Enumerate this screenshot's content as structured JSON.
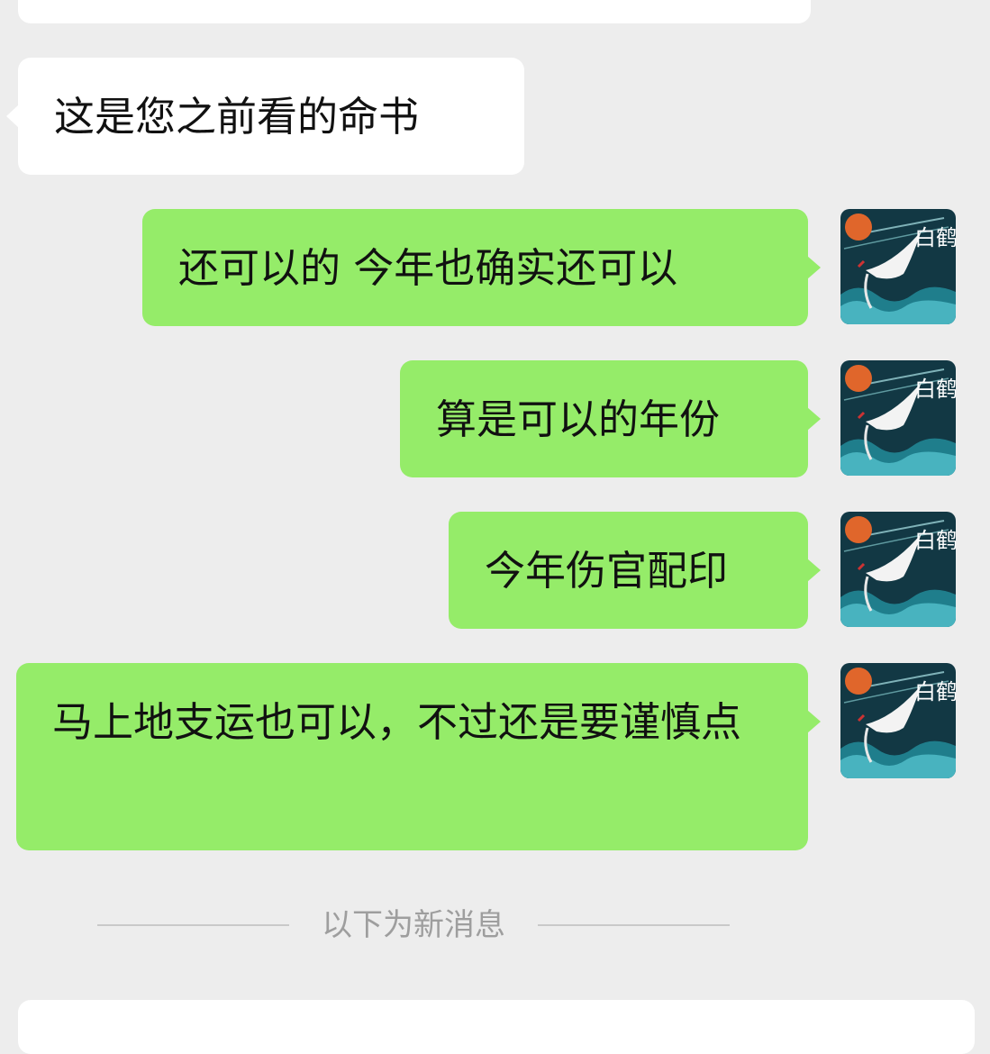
{
  "messages": [
    {
      "sender": "other",
      "text": "这是您之前看的命书"
    },
    {
      "sender": "me",
      "text": "还可以的 今年也确实还可以"
    },
    {
      "sender": "me",
      "text": "算是可以的年份"
    },
    {
      "sender": "me",
      "text": "今年伤官配印"
    },
    {
      "sender": "me",
      "text": "马上地支运也可以，不过还是要谨慎点"
    }
  ],
  "avatar": {
    "label": "白鹤",
    "icon": "crane-avatar-icon"
  },
  "divider": {
    "text": "以下为新消息"
  },
  "colors": {
    "background": "#ededed",
    "incoming_bubble": "#ffffff",
    "outgoing_bubble": "#95ec69",
    "divider_text": "#9e9e9e"
  }
}
